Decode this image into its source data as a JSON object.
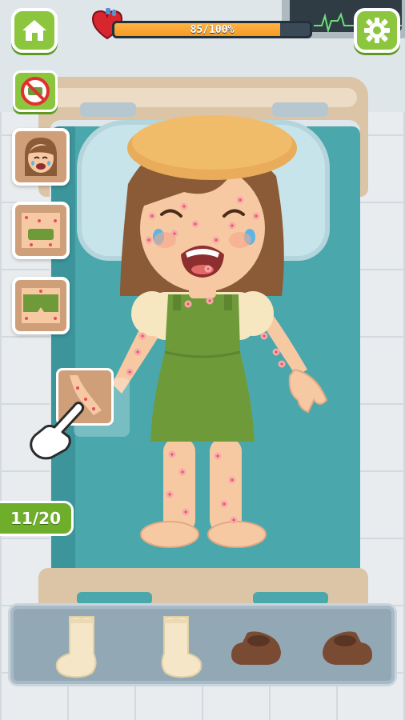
{
  "hud": {
    "progress_text": "85/100%",
    "progress_value": 85,
    "progress_max": 100
  },
  "level": {
    "counter_text": "11/20"
  },
  "body_parts": [
    "face",
    "torso",
    "hips",
    "arm"
  ],
  "wardrobe": [
    "sock-left",
    "sock-right",
    "shoe-left",
    "shoe-right"
  ],
  "colors": {
    "button_green": "#8cc63f",
    "progress_orange": "#f39a22",
    "rash_red": "#e84a5f",
    "mattress_teal": "#4aa7ac",
    "dress_green": "#6f9a3a"
  }
}
